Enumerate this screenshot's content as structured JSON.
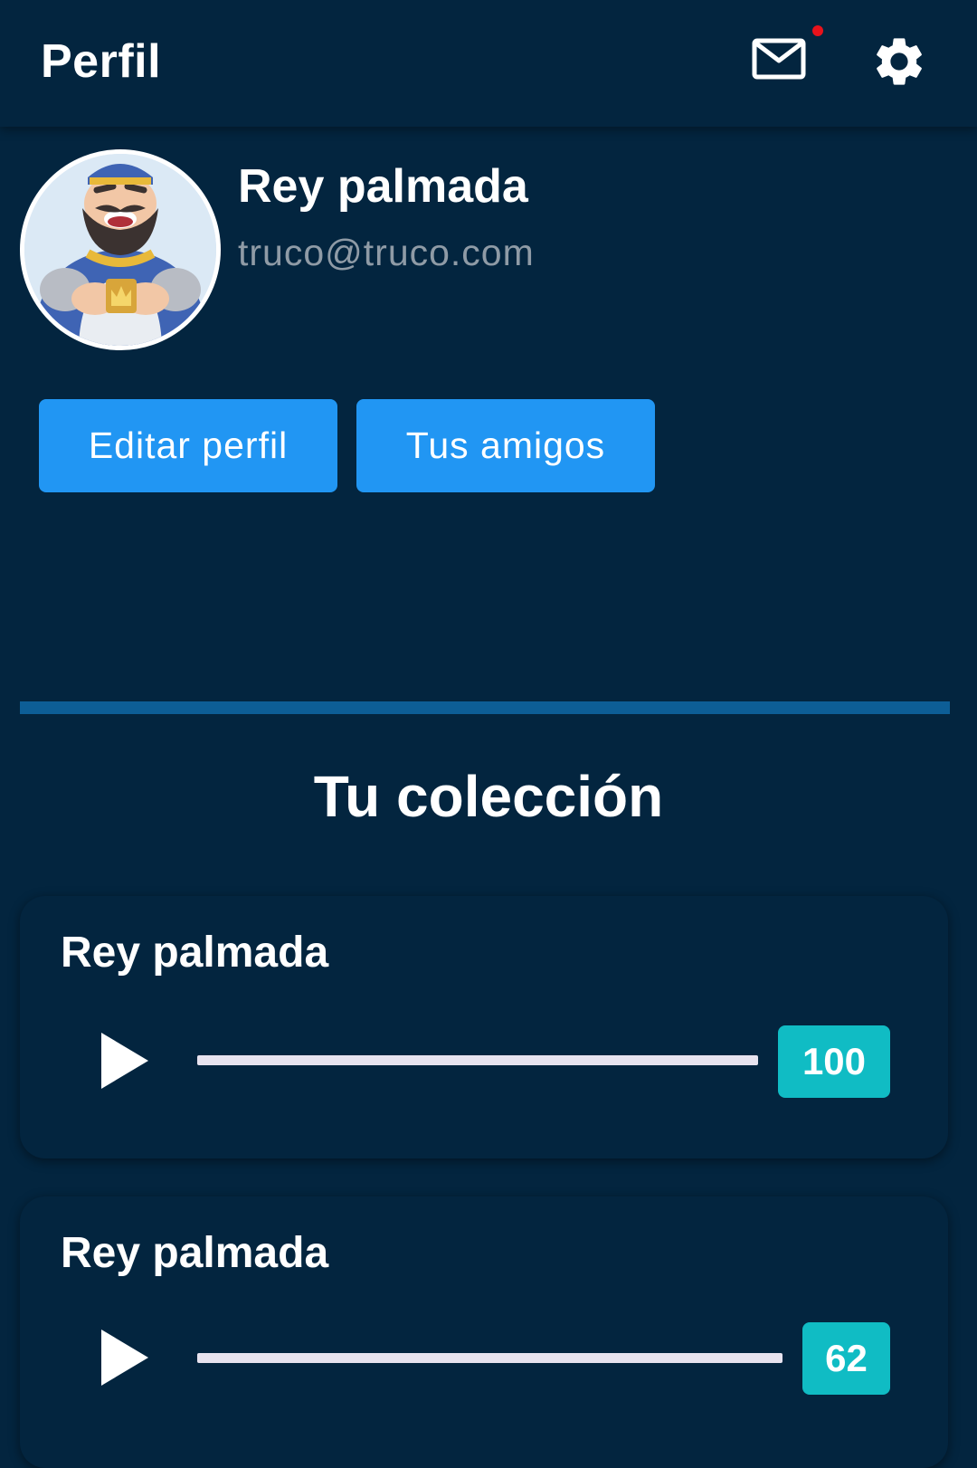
{
  "appbar": {
    "title": "Perfil",
    "mail_icon": "mail-icon",
    "settings_icon": "gear-icon",
    "notification_color": "#e8121b"
  },
  "profile": {
    "name": "Rey palmada",
    "email": "truco@truco.com",
    "avatar_icon": "king-avatar"
  },
  "actions": {
    "edit_label": "Editar perfil",
    "friends_label": "Tus amigos"
  },
  "collection": {
    "title": "Tu colección",
    "items": [
      {
        "name": "Rey palmada",
        "value": "100",
        "play_icon": "play-icon"
      },
      {
        "name": "Rey palmada",
        "value": "62",
        "play_icon": "play-icon"
      }
    ]
  },
  "colors": {
    "background": "#03253f",
    "primary_button": "#2196f3",
    "badge": "#10bcc4",
    "divider": "#0d5e96"
  }
}
